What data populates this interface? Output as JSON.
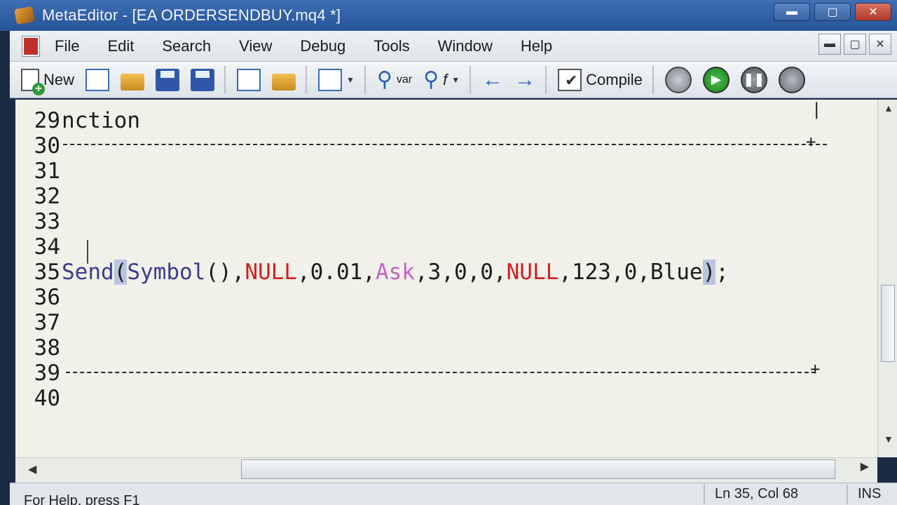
{
  "window": {
    "title": "MetaEditor - [EA ORDERSENDBUY.mq4 *]"
  },
  "window_controls": {
    "minimize": "▬",
    "maximize": "▢",
    "close": "✕"
  },
  "menu": {
    "items": [
      "File",
      "Edit",
      "Search",
      "View",
      "Debug",
      "Tools",
      "Window",
      "Help"
    ]
  },
  "toolbar": {
    "new_label": "New",
    "compile_label": "Compile",
    "var_label": "var",
    "fn_label": "f"
  },
  "editor": {
    "lines": [
      {
        "num": "29",
        "text": "nction"
      },
      {
        "num": "30",
        "text": ""
      },
      {
        "num": "31",
        "text": ""
      },
      {
        "num": "32",
        "text": ""
      },
      {
        "num": "33",
        "text": ""
      },
      {
        "num": "34",
        "text": ""
      },
      {
        "num": "35",
        "text": "Send(Symbol(),NULL,0.01,Ask,3,0,0,NULL,123,0,Blue);"
      },
      {
        "num": "36",
        "text": ""
      },
      {
        "num": "37",
        "text": ""
      },
      {
        "num": "38",
        "text": ""
      },
      {
        "num": "39",
        "text": ""
      },
      {
        "num": "40",
        "text": ""
      }
    ],
    "code35": {
      "send": "Send",
      "paren_open": "(",
      "symbol": "Symbol",
      "call": "()",
      "c1": ",",
      "null1": "NULL",
      "c2": ",",
      "lots": "0.01",
      "c3": ",",
      "ask": "Ask",
      "rest1": ",3,0,0,",
      "null2": "NULL",
      "rest2": ",123,0,Blue",
      "paren_close": ")",
      "semi": ";"
    },
    "colors": {
      "keyword_fn": "#3b3b8f",
      "null": "#d21f1f",
      "ask": "#c462c4"
    }
  },
  "status": {
    "help": "For Help, press F1",
    "position": "Ln 35, Col 68",
    "mode": "INS"
  }
}
